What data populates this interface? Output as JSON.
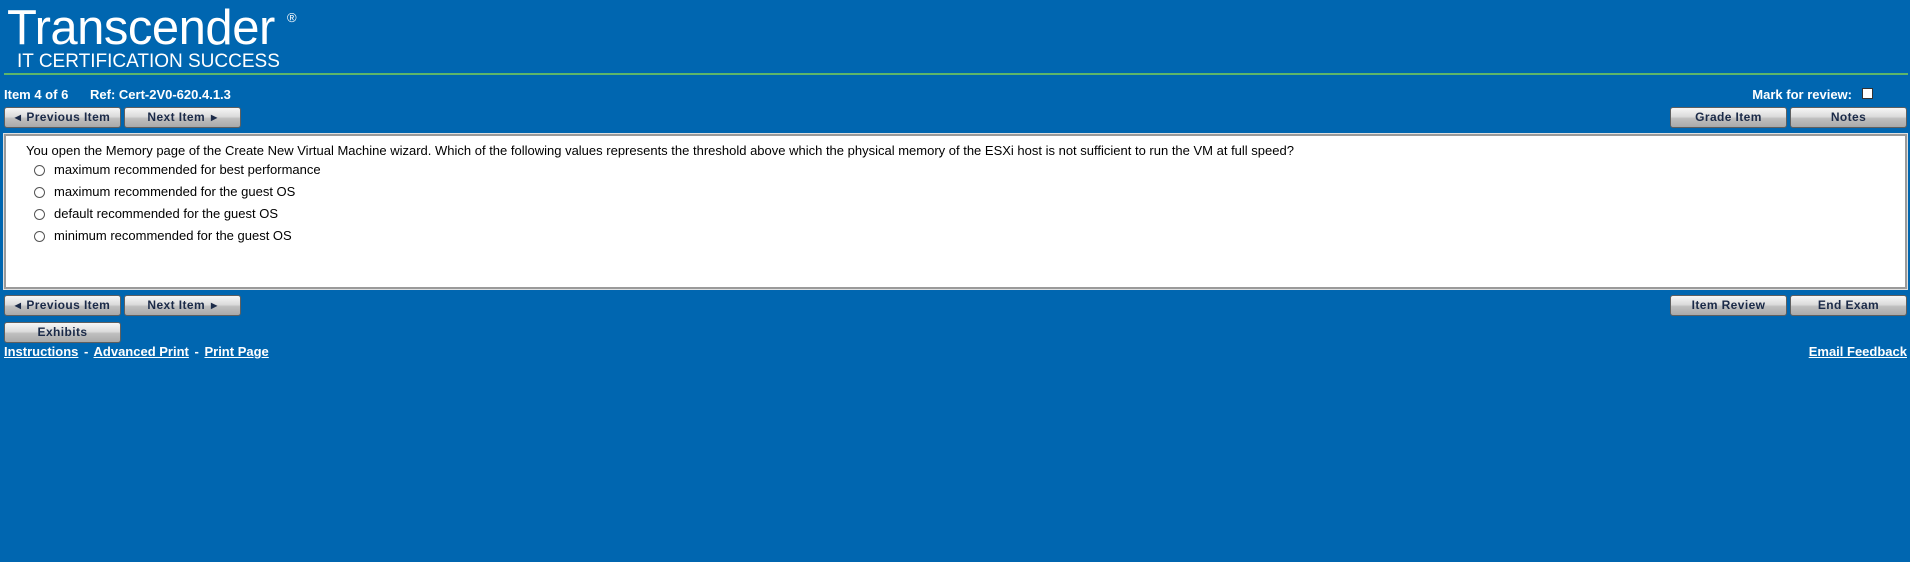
{
  "header": {
    "logo_main": "Transcender",
    "logo_reg": "®",
    "logo_sub": "IT CERTIFICATION SUCCESS"
  },
  "item_info": {
    "position": "Item 4 of 6",
    "ref": "Ref: Cert-2V0-620.4.1.3",
    "mark_review_label": "Mark for review:"
  },
  "nav": {
    "previous_label": "Previous Item",
    "next_label": "Next Item",
    "grade_label": "Grade Item",
    "notes_label": "Notes",
    "item_review_label": "Item Review",
    "end_exam_label": "End Exam",
    "exhibits_label": "Exhibits"
  },
  "question": {
    "text": "You open the Memory page of the Create New Virtual Machine wizard. Which of the following values represents the threshold above which the physical memory of the ESXi host is not sufficient to run the VM at full speed?",
    "options": [
      "maximum recommended for best performance",
      "maximum recommended for the guest OS",
      "default recommended for the guest OS",
      "minimum recommended for the guest OS"
    ]
  },
  "footer": {
    "instructions": "Instructions",
    "advanced_print": "Advanced Print",
    "print_page": "Print Page",
    "separator": "-",
    "email_feedback": "Email Feedback"
  },
  "colors": {
    "background": "#0066b0",
    "header_line": "#5db56a",
    "button_text": "#1b2a48"
  }
}
